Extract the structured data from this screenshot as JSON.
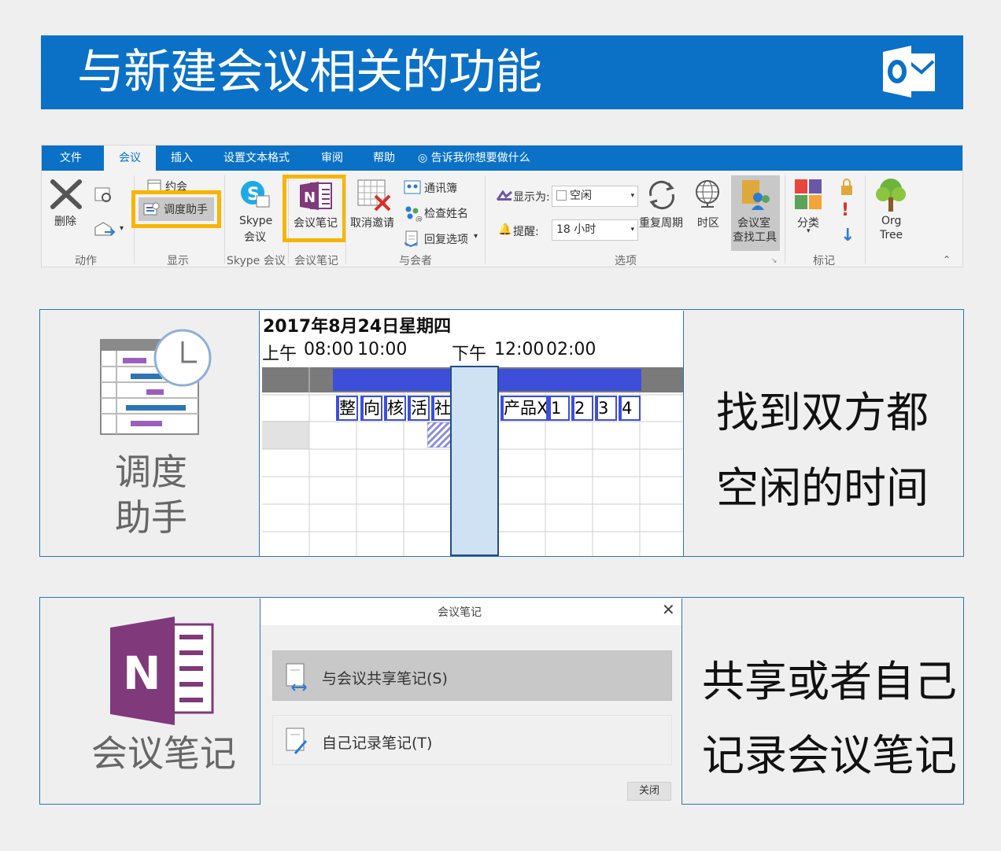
{
  "title": "与新建会议相关的功能",
  "tabs": [
    {
      "label": "文件"
    },
    {
      "label": "会议"
    },
    {
      "label": "插入"
    },
    {
      "label": "设置文本格式"
    },
    {
      "label": "审阅"
    },
    {
      "label": "帮助"
    },
    {
      "label": "告诉我你想要做什么"
    }
  ],
  "ribbon": {
    "delete": "删除",
    "appointment": "约会",
    "scheduling_assistant": "调度助手",
    "skype_line1": "Skype",
    "skype_line2": "会议",
    "meeting_notes": "会议笔记",
    "cancel_invite": "取消邀请",
    "address_book": "通讯簿",
    "check_names": "检查姓名",
    "response_options": "回复选项",
    "show_as_label": "显示为:",
    "show_as_value": "空闲",
    "reminder_label": "提醒:",
    "reminder_value": "18 小时",
    "recurrence": "重复周期",
    "time_zones": "时区",
    "room_finder_line1": "会议室",
    "room_finder_line2": "查找工具",
    "categorize": "分类",
    "org_tree_line1": "Org",
    "org_tree_line2": "Tree",
    "groups": [
      "动作",
      "显示",
      "Skype 会议",
      "会议笔记",
      "与会者",
      "选项",
      "标记"
    ]
  },
  "scheduler": {
    "panel_label_line1": "调度",
    "panel_label_line2": "助手",
    "date": "2017年8月24日星期四",
    "am": "上午",
    "t1": "08:00",
    "t2": "10:00",
    "pm": "下午",
    "t3": "12:00",
    "t4": "02:00",
    "events": [
      "整",
      "向",
      "核",
      "活",
      "社",
      "产品X",
      "1",
      "2",
      "3",
      "4"
    ],
    "caption_line1": "找到双方都",
    "caption_line2": "空闲的时间"
  },
  "notes": {
    "panel_label": "会议笔记",
    "dialog_title": "会议笔记",
    "share_option": "与会议共享笔记(S)",
    "self_option": "自己记录笔记(T)",
    "close_button": "关闭",
    "caption_line1": "共享或者自己",
    "caption_line2": "记录会议笔记"
  },
  "colors": {
    "brand_blue": "#0a71c7",
    "highlight": "#f7b500",
    "event_blue": "#3d4fd9",
    "selection": "#cfe2f3",
    "onenote_purple": "#80397b"
  }
}
